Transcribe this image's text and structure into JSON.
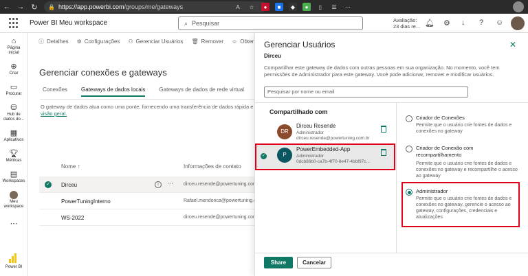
{
  "browser": {
    "url_host": "https://app.powerbi.com",
    "url_path": "/groups/me/gateways"
  },
  "header": {
    "brand": "Power BI",
    "workspace": "Meu workspace",
    "search_placeholder": "Pesquisar",
    "trial_line1": "Avaliação:",
    "trial_line2": "23 dias re..."
  },
  "left_nav": {
    "items": [
      {
        "label1": "Página",
        "label2": "inicial"
      },
      {
        "label1": "Criar",
        "label2": ""
      },
      {
        "label1": "Procurar",
        "label2": ""
      },
      {
        "label1": "Hub de",
        "label2": "dados do..."
      },
      {
        "label1": "Aplicativos",
        "label2": ""
      },
      {
        "label1": "Métricas",
        "label2": ""
      },
      {
        "label1": "Workspaces",
        "label2": ""
      },
      {
        "label1": "Meu",
        "label2": "workspace"
      },
      {
        "label1": "Power BI",
        "label2": ""
      }
    ]
  },
  "toolbar": {
    "details": "Detalhes",
    "settings": "Configurações",
    "manage_users": "Gerenciar Usuários",
    "remove": "Remover",
    "help": "Obter ajuda"
  },
  "main": {
    "title": "Gerenciar conexões e gateways",
    "tabs": [
      "Conexões",
      "Gateways de dados locais",
      "Gateways de dados de rede virtual"
    ],
    "description": "O gateway de dados atua como uma ponte, fornecendo uma transferência de dados rápida e",
    "description_link": "visão geral.",
    "table_headers": {
      "name": "Nome ↑",
      "contact": "Informações de contato"
    },
    "rows": [
      {
        "name": "Dirceu",
        "contact": "dirceu.resende@powertuning.com.br"
      },
      {
        "name": "PowerTuningInterno",
        "contact": "Rafael.mendonca@powertuning.com.br"
      },
      {
        "name": "WS-2022",
        "contact": "dirceu.resende@powertuning.com.br"
      }
    ]
  },
  "panel": {
    "title": "Gerenciar Usuários",
    "gateway": "Dirceu",
    "description": "Compartilhar este gateway de dados com outras pessoas em sua organização. No momento, você tem permissões de Administrador para este gateway. Você pode adicionar, remover e modificar usuários.",
    "search_placeholder": "Pesquisar por nome ou email",
    "shared_with_label": "Compartilhado com",
    "shared_users": [
      {
        "initials": "DR",
        "name": "Dirceu Resende",
        "role": "Administrador",
        "email": "dirceu.resende@powertuning.com.br",
        "color": "#8b4a2b"
      },
      {
        "initials": "P",
        "name": "PowerEmbedded-App",
        "role": "Administrador",
        "email": "0dcb86b0-ca7b-4f70-8e47-4bbf97c...",
        "color": "#0b5560"
      }
    ],
    "roles": [
      {
        "title": "Criador de Conexões",
        "desc": "Permite que o usuário crie fontes de dados e conexões no gateway"
      },
      {
        "title": "Criador de Conexão com recompartilhamento",
        "desc": "Permite que o usuário crie fontes de dados e conexões no gateway e recompartilhe o acesso ao gateway"
      },
      {
        "title": "Administrador",
        "desc": "Permite que o usuário crie fontes de dados e conexões no gateway, gerencie o acesso ao gateway, configurações, credenciais e atualizações"
      }
    ],
    "share_label": "Share",
    "cancel_label": "Cancelar"
  },
  "colors": {
    "accent": "#117865",
    "highlight": "#e3001b"
  }
}
